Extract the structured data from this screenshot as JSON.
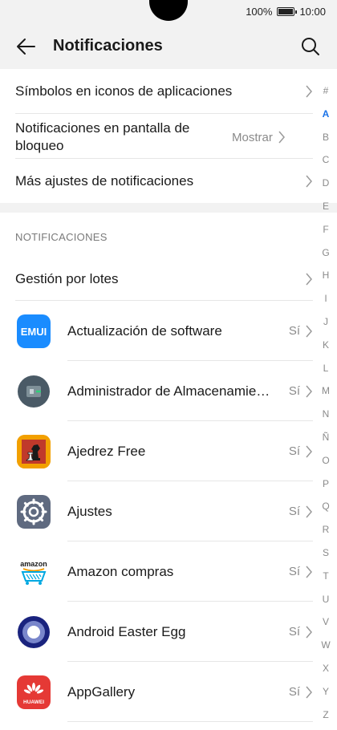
{
  "status_bar": {
    "battery_percent": "100%",
    "time": "10:00"
  },
  "header": {
    "title": "Notificaciones",
    "back_icon": "arrow-left-icon",
    "search_icon": "search-icon"
  },
  "settings": {
    "badges": {
      "label": "Símbolos en iconos de aplicaciones"
    },
    "lockscreen": {
      "label": "Notificaciones en pantalla de bloqueo",
      "value": "Mostrar"
    },
    "more": {
      "label": "Más ajustes de notificaciones"
    }
  },
  "section_title": "NOTIFICACIONES",
  "batch": {
    "label": "Gestión por lotes"
  },
  "apps": [
    {
      "name": "Actualización de software",
      "value": "Sí",
      "icon": "emui-icon",
      "icon_color": "#1a8cff"
    },
    {
      "name": "Administrador de Almacenamie…",
      "value": "Sí",
      "icon": "storage-manager-icon",
      "icon_color": "#4a5a66"
    },
    {
      "name": "Ajedrez Free",
      "value": "Sí",
      "icon": "chess-icon",
      "icon_color": "#f2a000"
    },
    {
      "name": "Ajustes",
      "value": "Sí",
      "icon": "settings-gear-icon",
      "icon_color": "#5f6a80"
    },
    {
      "name": "Amazon compras",
      "value": "Sí",
      "icon": "amazon-icon",
      "icon_color": "#00a8e1"
    },
    {
      "name": "Android Easter Egg",
      "value": "Sí",
      "icon": "easter-egg-icon",
      "icon_color": "#1a237e"
    },
    {
      "name": "AppGallery",
      "value": "Sí",
      "icon": "appgallery-icon",
      "icon_color": "#e53935",
      "icon_text": "HUAWEI"
    }
  ],
  "alphabet": [
    "#",
    "A",
    "B",
    "C",
    "D",
    "E",
    "F",
    "G",
    "H",
    "I",
    "J",
    "K",
    "L",
    "M",
    "N",
    "Ñ",
    "O",
    "P",
    "Q",
    "R",
    "S",
    "T",
    "U",
    "V",
    "W",
    "X",
    "Y",
    "Z"
  ],
  "alphabet_active": "A",
  "amazon_icon_text": "amazon"
}
